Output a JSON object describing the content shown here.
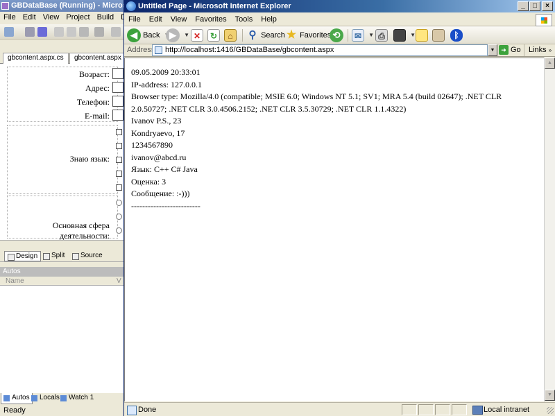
{
  "vs": {
    "title": "GBDataBase (Running) - Microsoft Vi",
    "menu": [
      "File",
      "Edit",
      "View",
      "Project",
      "Build",
      "Deb"
    ],
    "tabs": [
      "gbcontent.aspx.cs",
      "gbcontent.aspx"
    ],
    "form_labels": {
      "age": "Возраст:",
      "address": "Адрес:",
      "phone": "Телефон:",
      "email": "E-mail:",
      "languages": "Знаю язык:",
      "field_line1": "Основная сфера",
      "field_line2": "деятельности:"
    },
    "view_tabs": [
      "Design",
      "Split",
      "Source"
    ],
    "autos_title": "Autos",
    "autos_column": "Name",
    "autos_column_value": "V",
    "bottom_tabs": [
      "Autos",
      "Locals",
      "Watch 1"
    ],
    "status": "Ready"
  },
  "ie": {
    "title": "Untitled Page - Microsoft Internet Explorer",
    "menu": [
      "File",
      "Edit",
      "View",
      "Favorites",
      "Tools",
      "Help"
    ],
    "toolbar": {
      "back": "Back",
      "search": "Search",
      "favorites": "Favorites"
    },
    "address_label": "Address",
    "address_url": "http://localhost:1416/GBDataBase/gbcontent.aspx",
    "go_label": "Go",
    "links_label": "Links",
    "content_lines": [
      "09.05.2009 20:33:01",
      "IP-address: 127.0.0.1",
      "Browser type: Mozilla/4.0 (compatible; MSIE 6.0; Windows NT 5.1; SV1; MRA 5.4 (build 02647); .NET CLR 2.0.50727; .NET CLR 3.0.4506.2152; .NET CLR 3.5.30729; .NET CLR 1.1.4322)",
      "Ivanov P.S., 23",
      "Kondryaevo, 17",
      "1234567890",
      "ivanov@abcd.ru",
      "Язык: C++ C# Java",
      "Оценка: 3",
      "Сообщение: :-)))",
      "-------------------------"
    ],
    "status_left": "Done",
    "status_zone": "Local intranet"
  }
}
